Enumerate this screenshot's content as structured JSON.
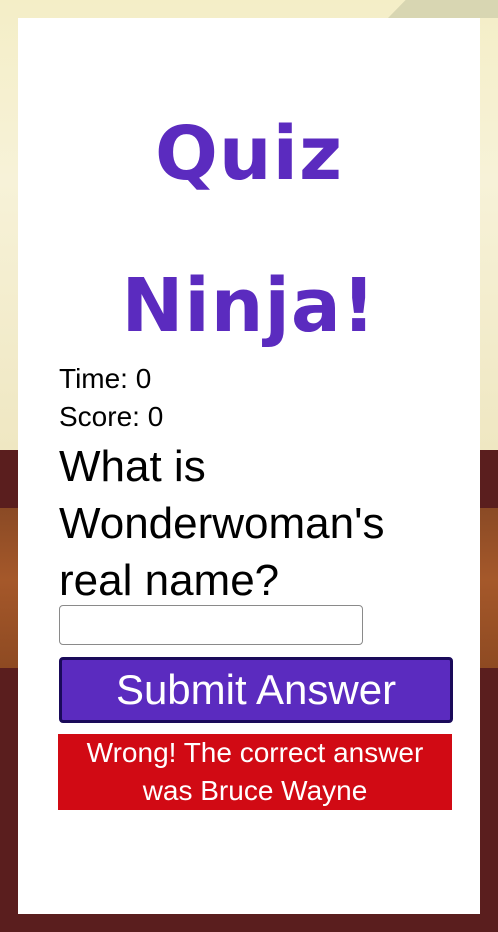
{
  "app": {
    "title_line1": "Quiz",
    "title_line2": "Ninja!",
    "accent_color": "#5b2bbf"
  },
  "stats": {
    "time_label": "Time:",
    "time_value": "0",
    "score_label": "Score:",
    "score_value": "0"
  },
  "question": {
    "text": "What is Wonderwoman's real name?"
  },
  "answer_field": {
    "value": "",
    "placeholder": ""
  },
  "submit": {
    "label": "Submit Answer"
  },
  "feedback": {
    "text": "Wrong! The correct answer was Bruce Wayne",
    "color": "#d10a14"
  }
}
